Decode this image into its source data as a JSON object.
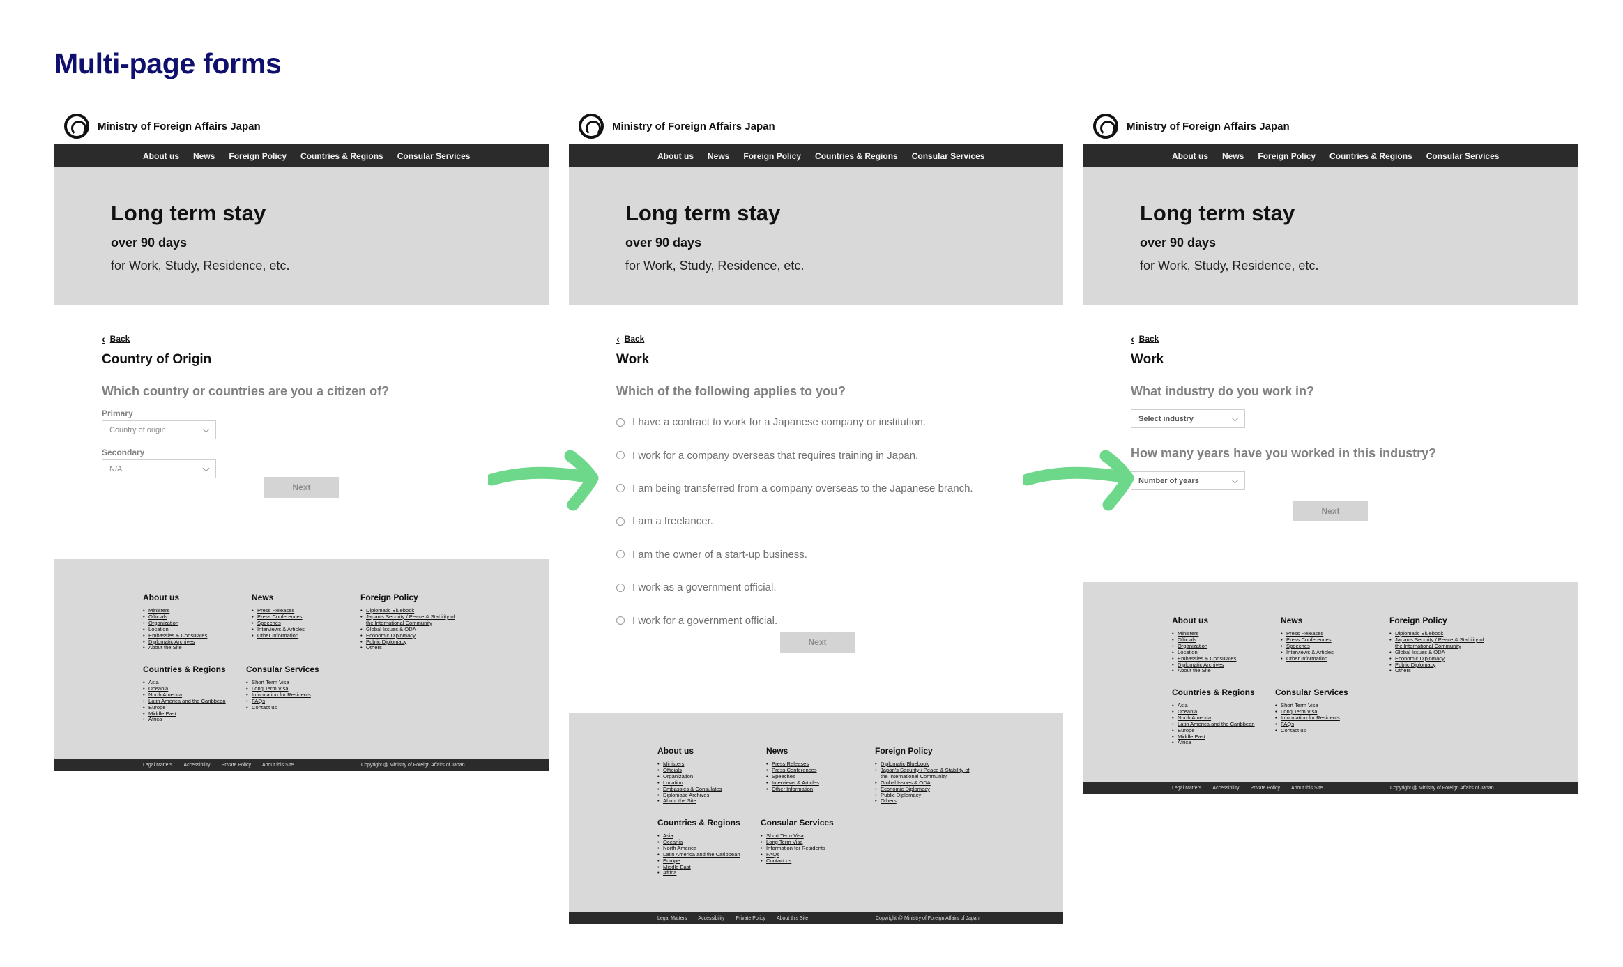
{
  "page": {
    "title": "Multi-page forms"
  },
  "site": {
    "name": "Ministry of Foreign Affairs Japan",
    "nav": [
      "About us",
      "News",
      "Foreign Policy",
      "Countries & Regions",
      "Consular Services"
    ],
    "hero": {
      "title": "Long term stay",
      "subtitle": "over 90 days",
      "description": "for Work, Study, Residence, etc."
    },
    "back": "Back",
    "next": "Next",
    "footer": {
      "about": {
        "heading": "About us",
        "links": [
          "Ministers",
          "Officials",
          "Organization",
          "Location",
          "Embassies & Consulates",
          "Diplomatic Archives",
          "About the Site"
        ]
      },
      "news": {
        "heading": "News",
        "links": [
          "Press Releases",
          "Press Conferences",
          "Speeches",
          "Interviews & Articles",
          "Other Information"
        ]
      },
      "policy": {
        "heading": "Foreign Policy",
        "links": [
          "Diplomatic Bluebook",
          "Japan's Security / Peace & Stability of",
          "the International Community",
          "Global Issues & ODA",
          "Economic Diplomacy",
          "Public Diplomacy",
          "Others"
        ]
      },
      "regions": {
        "heading": "Countries & Regions",
        "links": [
          "Asia",
          "Oceania",
          "North America",
          "Latin America and the Caribbean",
          "Europe",
          "Middle East",
          "Africa"
        ]
      },
      "consular": {
        "heading": "Consular Services",
        "links": [
          "Short Term Visa",
          "Long Term Visa",
          "Information for Residents",
          "FAQs",
          "Contact us"
        ]
      },
      "bottom_links": [
        "Legal Matters",
        "Accessibility",
        "Private Policy",
        "About this Site"
      ],
      "copyright": "Copyright @ Ministry of Foreign Affairs of Japan"
    }
  },
  "step1": {
    "section": "Country of Origin",
    "question": "Which country or countries are you a citizen of?",
    "primary_label": "Primary",
    "primary_value": "Country of origin",
    "secondary_label": "Secondary",
    "secondary_value": "N/A"
  },
  "step2": {
    "section": "Work",
    "question": "Which of the following applies to you?",
    "options": [
      "I have a contract to work for a Japanese company or institution.",
      "I work for a company overseas that requires training in Japan.",
      "I am being transferred from a company overseas to the Japanese branch.",
      "I am a freelancer.",
      "I am the owner of a start-up business.",
      "I work as a government official.",
      "I work for a government official."
    ]
  },
  "step3": {
    "section": "Work",
    "question1": "What industry do you work in?",
    "industry_value": "Select industry",
    "question2": "How many years have you worked in this industry?",
    "years_value": "Number of years"
  },
  "colors": {
    "title": "#0f0f6e",
    "nav": "#2b2b2b",
    "hero": "#d9d9d9",
    "arrow": "#6dd889"
  }
}
